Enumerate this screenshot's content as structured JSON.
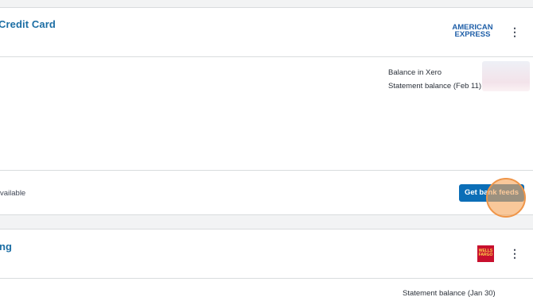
{
  "accounts": [
    {
      "title": "Credit Card",
      "logo": {
        "icon": "american-express-logo",
        "lines": [
          "AMERICAN",
          "EXPRESS"
        ],
        "color": "#1f5fa8"
      },
      "balance_labels": [
        "Balance in Xero",
        "Statement balance (Feb 11)"
      ],
      "footer_text": "vailable",
      "action_label": "Get bank feeds"
    },
    {
      "title": "ng",
      "logo": {
        "icon": "wells-fargo-logo",
        "lines": [
          "WELLS",
          "FARGO"
        ],
        "color": "#c8102e"
      },
      "balance_labels": [
        "Statement balance (Jan 30)"
      ]
    }
  ],
  "menu_icon": "vertical-ellipsis-icon",
  "colors": {
    "accent": "#0b6eb7",
    "link": "#1c6ea4",
    "click_highlight": "#f5a65c"
  }
}
